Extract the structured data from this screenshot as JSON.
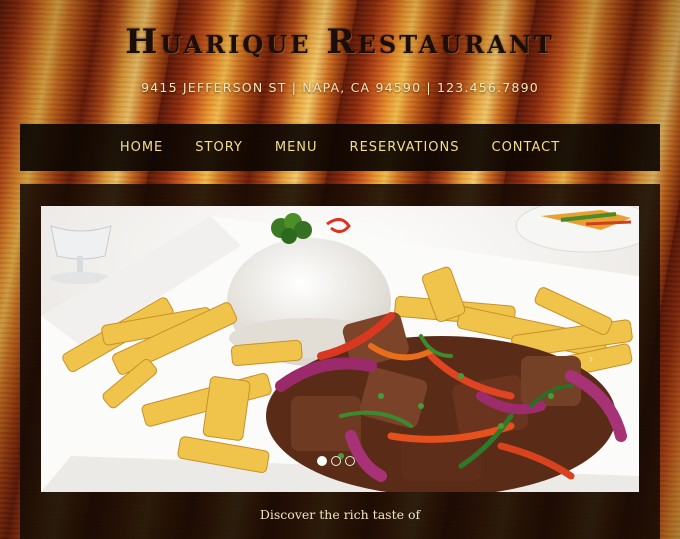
{
  "header": {
    "title": "Huarique Restaurant",
    "address": "9415 JEFFERSON ST | NAPA, CA 94590 | 123.456.7890"
  },
  "nav": {
    "items": [
      "HOME",
      "STORY",
      "MENU",
      "RESERVATIONS",
      "CONTACT"
    ]
  },
  "slider": {
    "image_alt": "Plate of lomo saltado with white rice and french fries",
    "slide_count": 3,
    "active_slide": 1,
    "tagline": "Discover the rich taste of"
  },
  "colors": {
    "nav_text": "#f3dd8e",
    "nav_background": "#0c0602",
    "title": "#1c0e06",
    "address": "#f6e6b8"
  }
}
